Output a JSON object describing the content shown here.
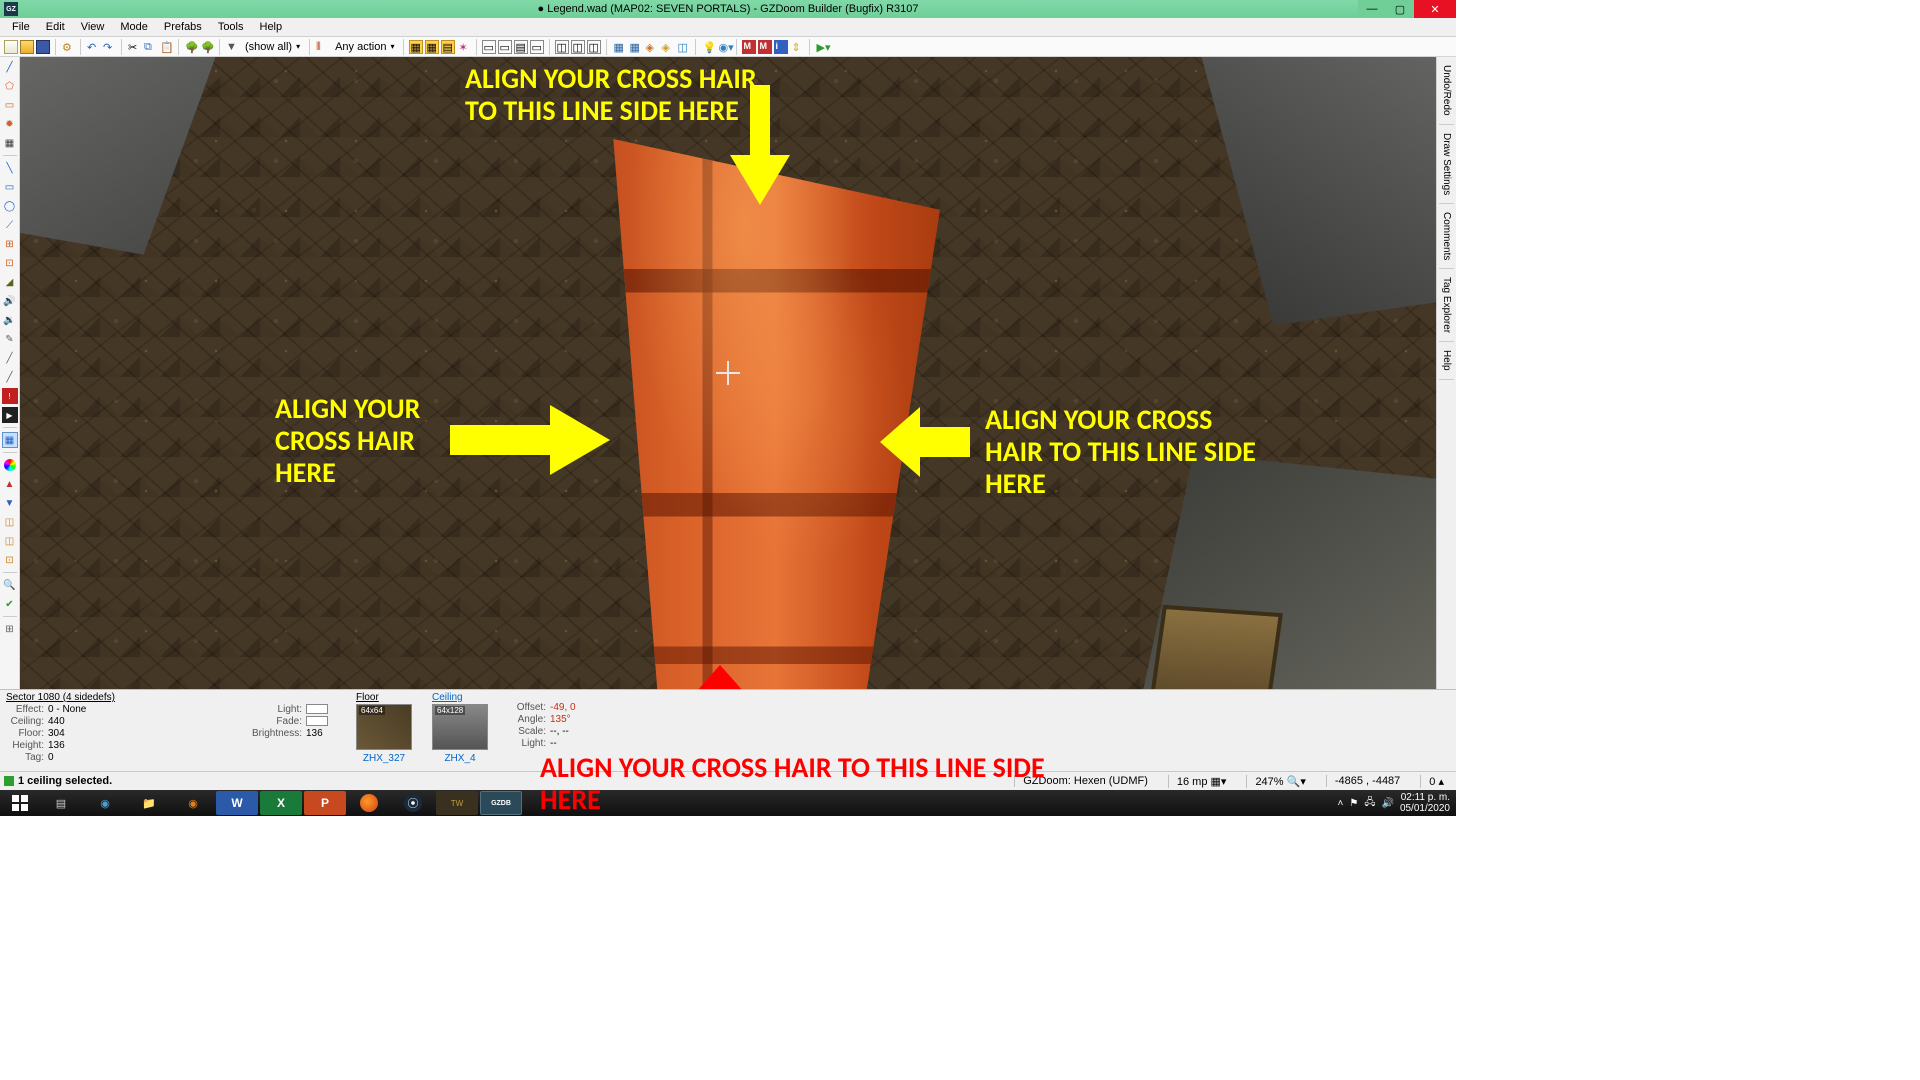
{
  "titlebar": {
    "icon_text": "GZ",
    "modified_dot": "●",
    "title": "Legend.wad (MAP02: SEVEN PORTALS) - GZDoom Builder (Bugfix) R3107"
  },
  "menu": {
    "items": [
      "File",
      "Edit",
      "View",
      "Mode",
      "Prefabs",
      "Tools",
      "Help"
    ]
  },
  "toolbar": {
    "filter_label": "(show all)",
    "action_label": "Any action"
  },
  "right_tabs": [
    "Undo/Redo",
    "Draw Settings",
    "Comments",
    "Tag Explorer",
    "Help"
  ],
  "annotations": {
    "top": "ALIGN YOUR CROSS HAIR TO THIS LINE SIDE HERE",
    "left": "ALIGN YOUR CROSS HAIR HERE",
    "right": "ALIGN YOUR CROSS HAIR TO THIS LINE SIDE HERE",
    "bottom": "ALIGN YOUR CROSS HAIR TO THIS LINE SIDE HERE"
  },
  "info": {
    "sector_header": "Sector 1080 (4 sidedefs)",
    "effect_lbl": "Effect:",
    "effect": "0 - None",
    "ceiling_lbl": "Ceiling:",
    "ceiling": "440",
    "floor_lbl": "Floor:",
    "floor": "304",
    "height_lbl": "Height:",
    "height": "136",
    "tag_lbl": "Tag:",
    "tag": "0",
    "light_lbl": "Light:",
    "fade_lbl": "Fade:",
    "bright_lbl": "Brightness:",
    "bright": "136",
    "floor_hdr": "Floor",
    "floor_dim": "64x64",
    "floor_tex": "ZHX_327",
    "ceil_hdr": "Ceiling",
    "ceil_dim": "64x128",
    "ceil_tex": "ZHX_4",
    "off_lbl": "Offset:",
    "off": "-49, 0",
    "ang_lbl": "Angle:",
    "ang": "135°",
    "scl_lbl": "Scale:",
    "scl": "--, --",
    "lt_lbl": "Light:",
    "lt": "--"
  },
  "status": {
    "msg": "1 ceiling selected.",
    "config": "GZDoom: Hexen (UDMF)",
    "grid": "16 mp",
    "zoom": "247%",
    "coords": "-4865 , -4487",
    "extra": "0"
  },
  "tray": {
    "time": "02:11 p. m.",
    "date": "05/01/2020"
  }
}
